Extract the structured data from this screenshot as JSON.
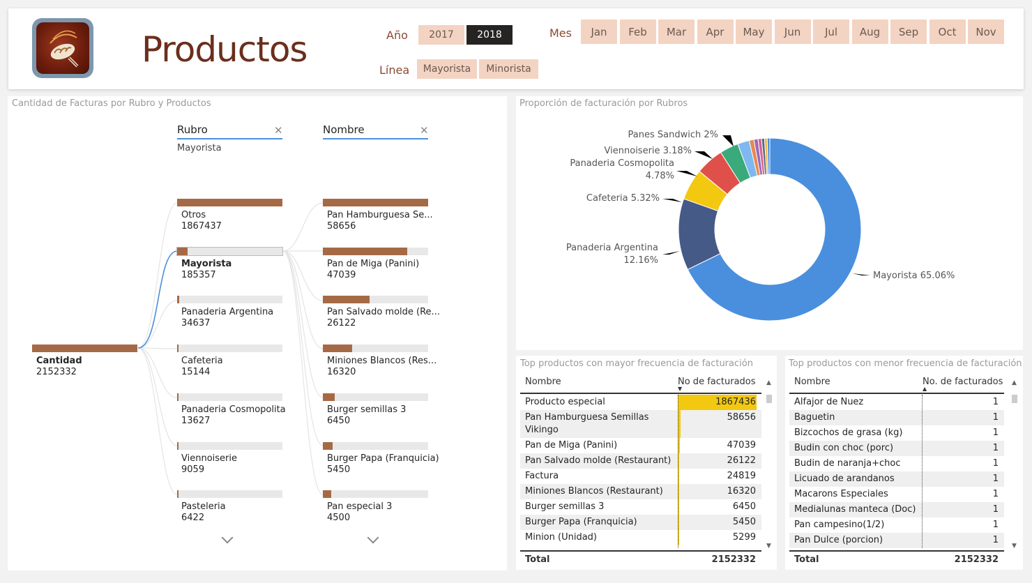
{
  "header": {
    "title": "Productos",
    "year_label": "Año",
    "years": [
      "2017",
      "2018"
    ],
    "year_selected": "2018",
    "month_label": "Mes",
    "months": [
      "Jan",
      "Feb",
      "Mar",
      "Apr",
      "May",
      "Jun",
      "Jul",
      "Aug",
      "Sep",
      "Oct",
      "Nov"
    ],
    "line_label": "Línea",
    "lines": [
      "Mayorista",
      "Minorista"
    ]
  },
  "decomp": {
    "title": "Cantidad de Facturas por Rubro y Productos",
    "root": {
      "name": "Cantidad",
      "value": "2152332"
    },
    "col1": {
      "header": "Rubro",
      "filter": "Mayorista"
    },
    "col2": {
      "header": "Nombre"
    },
    "rubros": [
      {
        "name": "Otros",
        "value": "1867437",
        "share": 1.0
      },
      {
        "name": "Mayorista",
        "value": "185357",
        "share": 0.099
      },
      {
        "name": "Panaderia Argentina",
        "value": "34637",
        "share": 0.0185
      },
      {
        "name": "Cafeteria",
        "value": "15144",
        "share": 0.0081
      },
      {
        "name": "Panaderia Cosmopolita",
        "value": "13627",
        "share": 0.0073
      },
      {
        "name": "Viennoiserie",
        "value": "9059",
        "share": 0.0049
      },
      {
        "name": "Pasteleria",
        "value": "6422",
        "share": 0.0034
      }
    ],
    "productos": [
      {
        "name": "Pan Hamburguesa Se...",
        "value": "58656",
        "share": 1.0
      },
      {
        "name": "Pan de Miga (Panini)",
        "value": "47039",
        "share": 0.802
      },
      {
        "name": "Pan Salvado molde (Re...",
        "value": "26122",
        "share": 0.445
      },
      {
        "name": "Miniones Blancos (Res...",
        "value": "16320",
        "share": 0.278
      },
      {
        "name": "Burger semillas 3",
        "value": "6450",
        "share": 0.11
      },
      {
        "name": "Burger Papa (Franquicia)",
        "value": "5450",
        "share": 0.093
      },
      {
        "name": "Pan especial 3",
        "value": "4500",
        "share": 0.077
      }
    ],
    "icons": [
      "close-icon",
      "chevron-down-icon"
    ]
  },
  "donut": {
    "title": "Proporción de facturación por Rubros",
    "labels": [
      {
        "name": "Panes Sandwich",
        "pct": "2%"
      },
      {
        "name": "Viennoiserie",
        "pct": "3.18%"
      },
      {
        "name": "Panaderia Cosmopolita",
        "pct": "4.78%"
      },
      {
        "name": "Cafeteria",
        "pct": "5.32%"
      },
      {
        "name": "Panaderia Argentina",
        "pct": "12.16%"
      },
      {
        "name": "Mayorista",
        "pct": "65.06%"
      }
    ]
  },
  "chart_data": {
    "type": "pie",
    "title": "Proporción de facturación por Rubros",
    "categories": [
      "Mayorista",
      "Panaderia Argentina",
      "Cafeteria",
      "Panaderia Cosmopolita",
      "Viennoiserie",
      "Panes Sandwich"
    ],
    "values": [
      65.06,
      12.16,
      5.32,
      4.78,
      3.18,
      2.0
    ],
    "colors": [
      "#4a8fdd",
      "#465a88",
      "#f2c811",
      "#e0504a",
      "#3aaa7b",
      "#7fb8f0"
    ],
    "other_slice_colors": [
      "#e8894e",
      "#9b6bb5",
      "#d4649a",
      "#5d6b79",
      "#e8b84e",
      "#4a8fdd"
    ]
  },
  "top_table": {
    "title": "Top productos con mayor frecuencia de facturación",
    "col_name": "Nombre",
    "col_value": "No de facturados",
    "rows": [
      {
        "name": "Producto especial",
        "value": "1867436",
        "share": 1.0
      },
      {
        "name": "Pan Hamburguesa Semillas Vikingo",
        "value": "58656",
        "share": 0.031
      },
      {
        "name": "Pan de Miga (Panini)",
        "value": "47039",
        "share": 0.025
      },
      {
        "name": "Pan Salvado molde (Restaurant)",
        "value": "26122",
        "share": 0.014
      },
      {
        "name": "Factura",
        "value": "24819",
        "share": 0.013
      },
      {
        "name": "Miniones Blancos (Restaurant)",
        "value": "16320",
        "share": 0.009
      },
      {
        "name": "Burger semillas 3",
        "value": "6450",
        "share": 0.004
      },
      {
        "name": "Burger Papa (Franquicia)",
        "value": "5450",
        "share": 0.003
      },
      {
        "name": "Minion (Unidad)",
        "value": "5299",
        "share": 0.003
      }
    ],
    "total_label": "Total",
    "total_value": "2152332",
    "highlight": "#f2c811"
  },
  "bottom_table": {
    "title": "Top productos con menor frecuencia de facturación",
    "col_name": "Nombre",
    "col_value": "No. de facturados",
    "rows": [
      {
        "name": "Alfajor de Nuez",
        "value": "1"
      },
      {
        "name": "Baguetin",
        "value": "1"
      },
      {
        "name": "Bizcochos de grasa (kg)",
        "value": "1"
      },
      {
        "name": "Budin con choc (porc)",
        "value": "1"
      },
      {
        "name": "Budin de naranja+choc",
        "value": "1"
      },
      {
        "name": "Licuado de arandanos",
        "value": "1"
      },
      {
        "name": "Macarons Especiales",
        "value": "1"
      },
      {
        "name": "Medialunas manteca (Doc)",
        "value": "1"
      },
      {
        "name": "Pan campesino(1/2)",
        "value": "1"
      },
      {
        "name": "Pan Dulce (porcion)",
        "value": "1"
      }
    ],
    "total_label": "Total",
    "total_value": "2152332"
  }
}
